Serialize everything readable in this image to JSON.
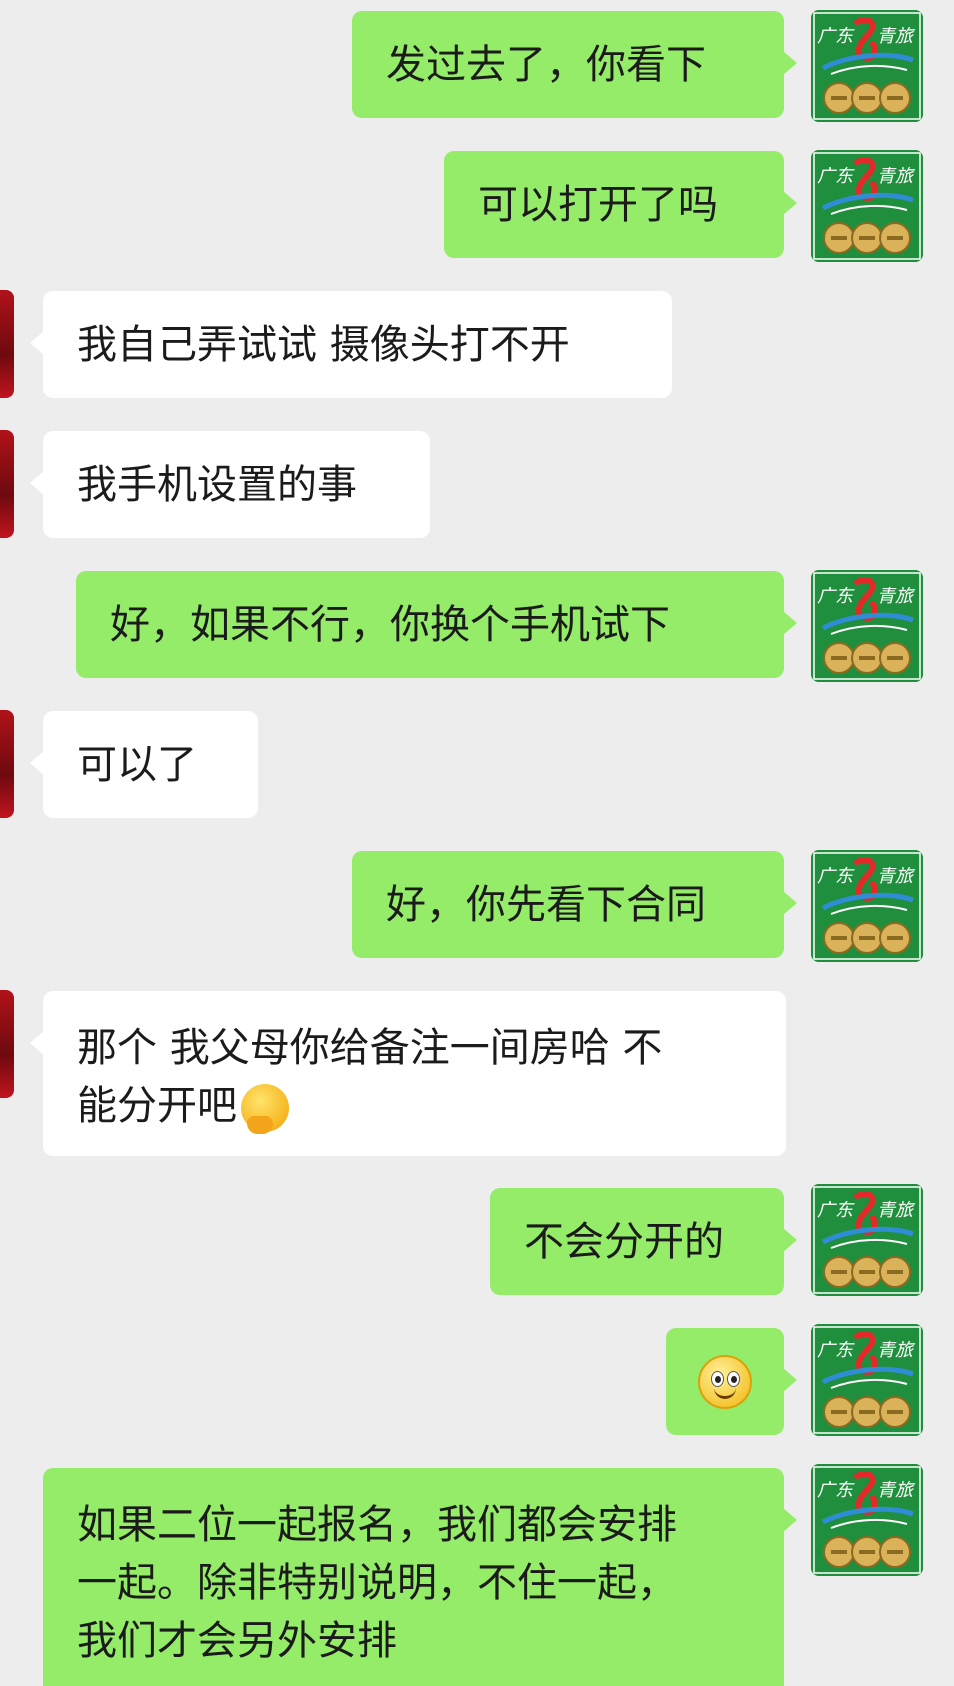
{
  "chat": {
    "avatar_icon": "guangdong-qinglv-logo-icon",
    "messages": [
      {
        "side": "out",
        "text": "发过去了，你看下"
      },
      {
        "side": "out",
        "text": "可以打开了吗"
      },
      {
        "side": "in",
        "text": "我自己弄试试 摄像头打不开"
      },
      {
        "side": "in",
        "text": "我手机设置的事"
      },
      {
        "side": "out",
        "text": "好，如果不行，你换个手机试下"
      },
      {
        "side": "in",
        "text": "可以了"
      },
      {
        "side": "out",
        "text": "好，你先看下合同"
      },
      {
        "side": "in",
        "line1": "那个 我父母你给备注一间房哈  不",
        "line2": "能分开吧",
        "emoji": "thinking-face-emoji-icon"
      },
      {
        "side": "out",
        "text": "不会分开的"
      },
      {
        "side": "out",
        "emoji": "smiley-face-emoji-icon"
      },
      {
        "side": "out",
        "line1": "如果二位一起报名，我们都会安排",
        "line2": "一起。除非特别说明，不住一起，",
        "line3": "我们才会另外安排"
      }
    ]
  }
}
